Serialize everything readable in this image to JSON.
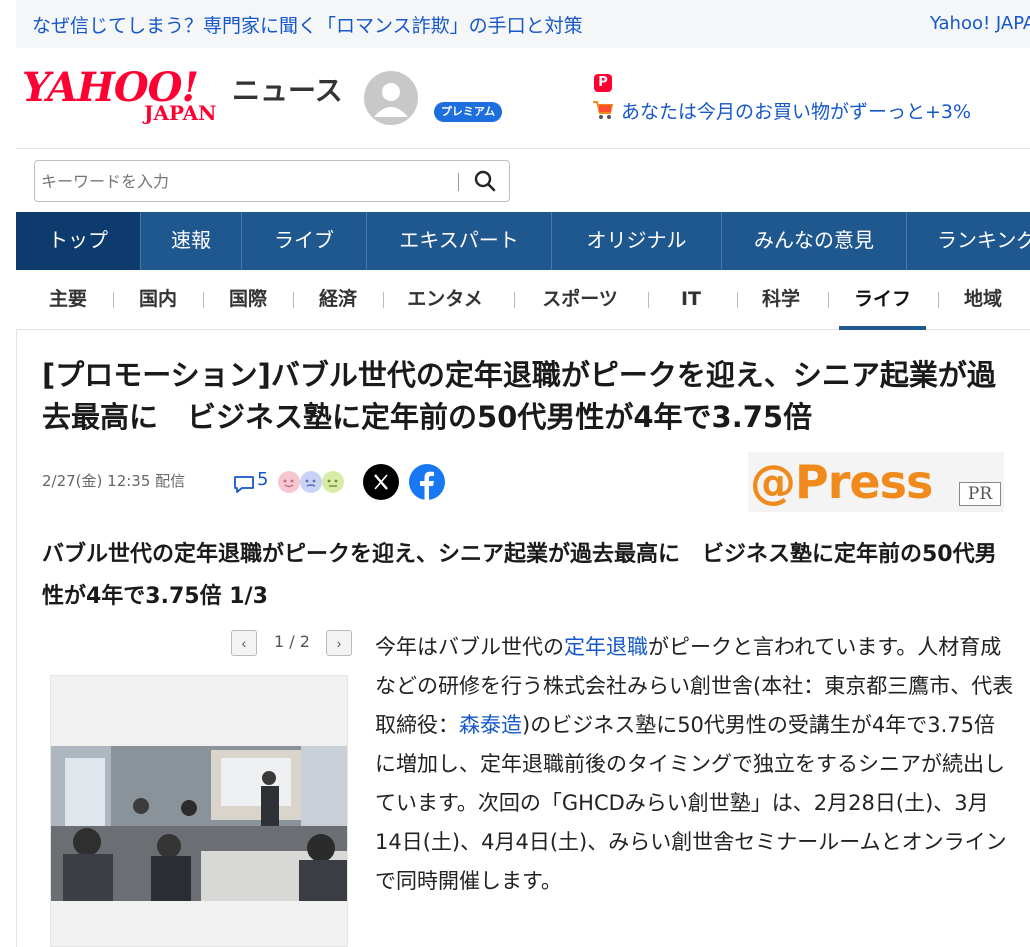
{
  "topbar": {
    "promo_text": "なぜ信じてしまう？専門家に聞く「ロマンス詐欺」の手口と対策",
    "yahoo_link": "Yahoo! JAPAN"
  },
  "header": {
    "logo_main": "YAHOO!",
    "logo_sub": "JAPAN",
    "logo_news": "ニュース",
    "premium_badge": "プレミアム",
    "pay_badge": "P",
    "shopping_text": "あなたは今月のお買い物がずーっと+3%"
  },
  "search": {
    "placeholder": "キーワードを入力",
    "value": ""
  },
  "main_nav": [
    {
      "label": "トップ",
      "active": true
    },
    {
      "label": "速報"
    },
    {
      "label": "ライブ"
    },
    {
      "label": "エキスパート"
    },
    {
      "label": "オリジナル"
    },
    {
      "label": "みんなの意見"
    },
    {
      "label": "ランキング"
    }
  ],
  "sub_nav": [
    {
      "label": "主要"
    },
    {
      "label": "国内"
    },
    {
      "label": "国際"
    },
    {
      "label": "経済"
    },
    {
      "label": "エンタメ"
    },
    {
      "label": "スポーツ"
    },
    {
      "label": "IT"
    },
    {
      "label": "科学"
    },
    {
      "label": "ライフ",
      "active": true
    },
    {
      "label": "地域"
    }
  ],
  "article": {
    "headline": "[プロモーション]バブル世代の定年退職がピークを迎え、シニア起業が過去最高に　ビジネス塾に定年前の50代男性が4年で3.75倍",
    "date": "2/27(金) 12:35",
    "date_suffix": "配信",
    "comment_count": "5",
    "source_brand": "@Press",
    "source_pr": "PR",
    "subheadline": "バブル世代の定年退職がピークを迎え、シニア起業が過去最高に　ビジネス塾に定年前の50代男性が4年で3.75倍 1/3",
    "pager": {
      "prev": "‹",
      "next": "›",
      "current": "1",
      "total": "2",
      "separator": " / "
    },
    "body": {
      "p1_a": "今年はバブル世代の",
      "p1_link1": "定年退職",
      "p1_b": "がピークと言われています。人材育成などの研修を行う株式会社みらい創世舎(本社：東京都三鷹市、代表取締役：",
      "p1_link2": "森泰造",
      "p1_c": ")のビジネス塾に50代男性の受講生が4年で3.75倍に増加し、定年退職前後のタイミングで独立をするシニアが続出しています。次回の「GHCDみらい創世塾」は、2月28日(土)、3月14日(土)、4月4日(土)、みらい創世舎セミナールームとオンラインで同時開催します。"
    }
  },
  "colors": {
    "nav_bg": "#1f578f",
    "nav_active": "#0e3b6e",
    "link": "#1658c9",
    "yahoo_red": "#ff0033",
    "atpress_orange": "#f08a1c"
  }
}
